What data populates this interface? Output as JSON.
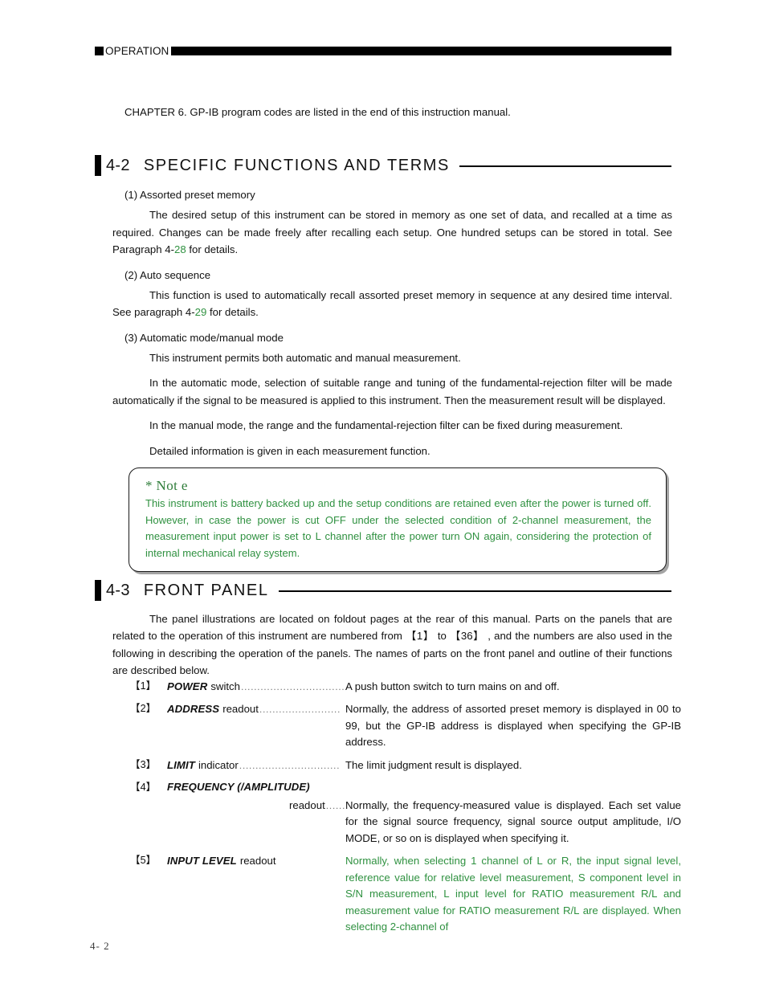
{
  "header": {
    "label": "OPERATION"
  },
  "intro_line": "CHAPTER 6. GP-IB program codes are listed in the end of this instruction manual.",
  "section_4_2": {
    "number": "4-2",
    "title": "SPECIFIC FUNCTIONS AND TERMS",
    "items": [
      {
        "label": "(1) Assorted preset memory"
      },
      {
        "label": "(2) Auto sequence"
      },
      {
        "label": "(3) Automatic mode/manual mode"
      }
    ],
    "paragraphs": {
      "p1_a": "The desired setup of this instrument can be stored in memory as one set of data, and recalled at a time as required. Changes can be made freely after recalling each setup. One hundred setups can be stored in total. See Paragraph 4-",
      "p1_ref": "28",
      "p1_b": " for details.",
      "p2_a": "This function is used to automatically recall assorted preset memory in sequence at any desired time interval. See paragraph 4-",
      "p2_ref": "29",
      "p2_b": " for details.",
      "p3": "This instrument permits both automatic and manual measurement.",
      "p4": "In the automatic mode, selection of suitable range and tuning of the fundamental-rejection filter will be made automatically if the signal to be measured is applied to this instrument. Then the measurement result will be displayed.",
      "p5": "In the manual mode, the range and the fundamental-rejection filter can be fixed during measurement.",
      "p6": "Detailed information is given in each measurement function."
    }
  },
  "note": {
    "title": "*  Not e",
    "body": "This instrument is battery backed up and the setup conditions are retained even after the power is turned off. However, in case the power is cut OFF under the selected condition of 2-channel measurement, the measurement input power is set to L channel after the power turn ON again, considering the protection of internal mechanical relay system."
  },
  "section_4_3": {
    "number": "4-3",
    "title": "FRONT PANEL",
    "intro_a": "The panel illustrations are located on foldout pages at the rear of this manual. Parts on the panels that are related to the operation of this instrument are numbered from ",
    "intro_ref1": "【1】",
    "intro_mid": " to ",
    "intro_ref2": "【36】",
    "intro_b": " , and the numbers are also used in the following in describing the operation of the panels. The names of parts on the front panel and outline of their functions are described below.",
    "parts": [
      {
        "tag": "【1】",
        "term": "POWER",
        "kind": "switch",
        "leader": "................................",
        "desc": "A push button switch to turn mains on and off.",
        "green": false,
        "layout": "inline"
      },
      {
        "tag": "【2】",
        "term": "ADDRESS",
        "kind": "readout",
        "leader": ".........................",
        "desc": "Normally, the address of assorted preset memory is displayed in 00 to 99, but the GP-IB address is displayed when specifying the GP-IB address.",
        "green": false,
        "layout": "inline"
      },
      {
        "tag": "【3】",
        "term": "LIMIT",
        "kind": "indicator",
        "leader": "...............................",
        "desc": "The limit judgment result is displayed.",
        "green": false,
        "layout": "inline"
      },
      {
        "tag": "【4】",
        "term": "FREQUENCY (/AMPLITUDE)",
        "kind": "readout",
        "leader": "......",
        "desc": "Normally, the frequency-measured value is displayed. Each set value for the signal source frequency, signal source output amplitude, I/O MODE, or so on is displayed when specifying it.",
        "green": false,
        "layout": "stacked"
      },
      {
        "tag": "【5】",
        "term": "INPUT LEVEL",
        "kind": "readout",
        "leader": "",
        "desc": "Normally, when selecting 1 channel of L or R, the input signal level, reference value for relative level measurement, S component level in S/N measurement, L input level for RATIO measurement R/L and measurement value for RATIO measurement R/L are displayed. When selecting 2-channel of",
        "green": true,
        "layout": "inline"
      }
    ]
  },
  "footer": {
    "page": "4- 2"
  },
  "colors": {
    "green": "#2f9140",
    "note_title_green": "#2f7d3a",
    "ink": "#111111"
  }
}
